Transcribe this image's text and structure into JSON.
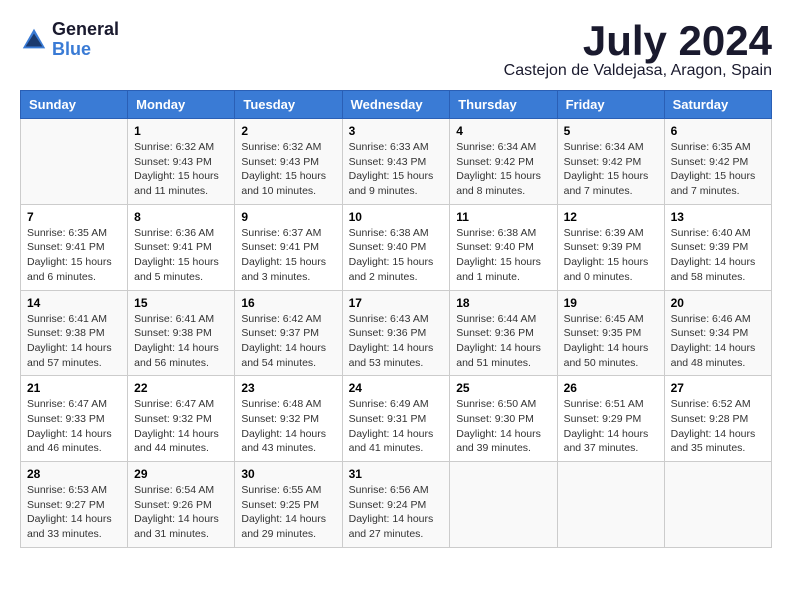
{
  "logo": {
    "general": "General",
    "blue": "Blue"
  },
  "title": "July 2024",
  "location": "Castejon de Valdejasa, Aragon, Spain",
  "days_of_week": [
    "Sunday",
    "Monday",
    "Tuesday",
    "Wednesday",
    "Thursday",
    "Friday",
    "Saturday"
  ],
  "weeks": [
    [
      {
        "day": "",
        "sunrise": "",
        "sunset": "",
        "daylight": ""
      },
      {
        "day": "1",
        "sunrise": "Sunrise: 6:32 AM",
        "sunset": "Sunset: 9:43 PM",
        "daylight": "Daylight: 15 hours and 11 minutes."
      },
      {
        "day": "2",
        "sunrise": "Sunrise: 6:32 AM",
        "sunset": "Sunset: 9:43 PM",
        "daylight": "Daylight: 15 hours and 10 minutes."
      },
      {
        "day": "3",
        "sunrise": "Sunrise: 6:33 AM",
        "sunset": "Sunset: 9:43 PM",
        "daylight": "Daylight: 15 hours and 9 minutes."
      },
      {
        "day": "4",
        "sunrise": "Sunrise: 6:34 AM",
        "sunset": "Sunset: 9:42 PM",
        "daylight": "Daylight: 15 hours and 8 minutes."
      },
      {
        "day": "5",
        "sunrise": "Sunrise: 6:34 AM",
        "sunset": "Sunset: 9:42 PM",
        "daylight": "Daylight: 15 hours and 7 minutes."
      },
      {
        "day": "6",
        "sunrise": "Sunrise: 6:35 AM",
        "sunset": "Sunset: 9:42 PM",
        "daylight": "Daylight: 15 hours and 7 minutes."
      }
    ],
    [
      {
        "day": "7",
        "sunrise": "Sunrise: 6:35 AM",
        "sunset": "Sunset: 9:41 PM",
        "daylight": "Daylight: 15 hours and 6 minutes."
      },
      {
        "day": "8",
        "sunrise": "Sunrise: 6:36 AM",
        "sunset": "Sunset: 9:41 PM",
        "daylight": "Daylight: 15 hours and 5 minutes."
      },
      {
        "day": "9",
        "sunrise": "Sunrise: 6:37 AM",
        "sunset": "Sunset: 9:41 PM",
        "daylight": "Daylight: 15 hours and 3 minutes."
      },
      {
        "day": "10",
        "sunrise": "Sunrise: 6:38 AM",
        "sunset": "Sunset: 9:40 PM",
        "daylight": "Daylight: 15 hours and 2 minutes."
      },
      {
        "day": "11",
        "sunrise": "Sunrise: 6:38 AM",
        "sunset": "Sunset: 9:40 PM",
        "daylight": "Daylight: 15 hours and 1 minute."
      },
      {
        "day": "12",
        "sunrise": "Sunrise: 6:39 AM",
        "sunset": "Sunset: 9:39 PM",
        "daylight": "Daylight: 15 hours and 0 minutes."
      },
      {
        "day": "13",
        "sunrise": "Sunrise: 6:40 AM",
        "sunset": "Sunset: 9:39 PM",
        "daylight": "Daylight: 14 hours and 58 minutes."
      }
    ],
    [
      {
        "day": "14",
        "sunrise": "Sunrise: 6:41 AM",
        "sunset": "Sunset: 9:38 PM",
        "daylight": "Daylight: 14 hours and 57 minutes."
      },
      {
        "day": "15",
        "sunrise": "Sunrise: 6:41 AM",
        "sunset": "Sunset: 9:38 PM",
        "daylight": "Daylight: 14 hours and 56 minutes."
      },
      {
        "day": "16",
        "sunrise": "Sunrise: 6:42 AM",
        "sunset": "Sunset: 9:37 PM",
        "daylight": "Daylight: 14 hours and 54 minutes."
      },
      {
        "day": "17",
        "sunrise": "Sunrise: 6:43 AM",
        "sunset": "Sunset: 9:36 PM",
        "daylight": "Daylight: 14 hours and 53 minutes."
      },
      {
        "day": "18",
        "sunrise": "Sunrise: 6:44 AM",
        "sunset": "Sunset: 9:36 PM",
        "daylight": "Daylight: 14 hours and 51 minutes."
      },
      {
        "day": "19",
        "sunrise": "Sunrise: 6:45 AM",
        "sunset": "Sunset: 9:35 PM",
        "daylight": "Daylight: 14 hours and 50 minutes."
      },
      {
        "day": "20",
        "sunrise": "Sunrise: 6:46 AM",
        "sunset": "Sunset: 9:34 PM",
        "daylight": "Daylight: 14 hours and 48 minutes."
      }
    ],
    [
      {
        "day": "21",
        "sunrise": "Sunrise: 6:47 AM",
        "sunset": "Sunset: 9:33 PM",
        "daylight": "Daylight: 14 hours and 46 minutes."
      },
      {
        "day": "22",
        "sunrise": "Sunrise: 6:47 AM",
        "sunset": "Sunset: 9:32 PM",
        "daylight": "Daylight: 14 hours and 44 minutes."
      },
      {
        "day": "23",
        "sunrise": "Sunrise: 6:48 AM",
        "sunset": "Sunset: 9:32 PM",
        "daylight": "Daylight: 14 hours and 43 minutes."
      },
      {
        "day": "24",
        "sunrise": "Sunrise: 6:49 AM",
        "sunset": "Sunset: 9:31 PM",
        "daylight": "Daylight: 14 hours and 41 minutes."
      },
      {
        "day": "25",
        "sunrise": "Sunrise: 6:50 AM",
        "sunset": "Sunset: 9:30 PM",
        "daylight": "Daylight: 14 hours and 39 minutes."
      },
      {
        "day": "26",
        "sunrise": "Sunrise: 6:51 AM",
        "sunset": "Sunset: 9:29 PM",
        "daylight": "Daylight: 14 hours and 37 minutes."
      },
      {
        "day": "27",
        "sunrise": "Sunrise: 6:52 AM",
        "sunset": "Sunset: 9:28 PM",
        "daylight": "Daylight: 14 hours and 35 minutes."
      }
    ],
    [
      {
        "day": "28",
        "sunrise": "Sunrise: 6:53 AM",
        "sunset": "Sunset: 9:27 PM",
        "daylight": "Daylight: 14 hours and 33 minutes."
      },
      {
        "day": "29",
        "sunrise": "Sunrise: 6:54 AM",
        "sunset": "Sunset: 9:26 PM",
        "daylight": "Daylight: 14 hours and 31 minutes."
      },
      {
        "day": "30",
        "sunrise": "Sunrise: 6:55 AM",
        "sunset": "Sunset: 9:25 PM",
        "daylight": "Daylight: 14 hours and 29 minutes."
      },
      {
        "day": "31",
        "sunrise": "Sunrise: 6:56 AM",
        "sunset": "Sunset: 9:24 PM",
        "daylight": "Daylight: 14 hours and 27 minutes."
      },
      {
        "day": "",
        "sunrise": "",
        "sunset": "",
        "daylight": ""
      },
      {
        "day": "",
        "sunrise": "",
        "sunset": "",
        "daylight": ""
      },
      {
        "day": "",
        "sunrise": "",
        "sunset": "",
        "daylight": ""
      }
    ]
  ]
}
